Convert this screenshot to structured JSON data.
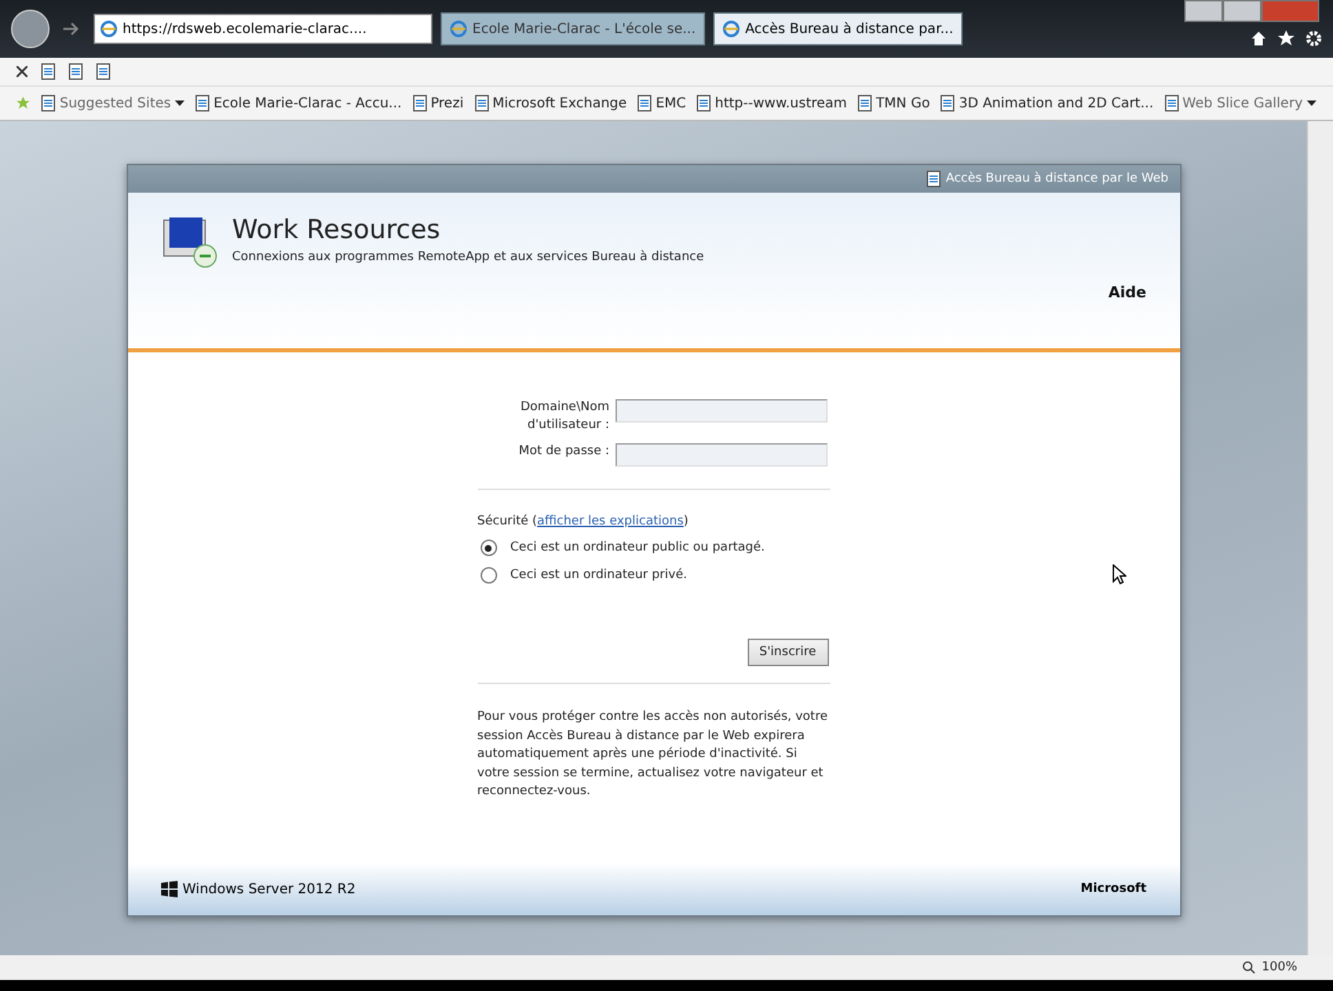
{
  "browser": {
    "address": "https://rdsweb.ecolemarie-clarac....",
    "tabs": [
      {
        "label": "Ecole Marie-Clarac - L'école se...",
        "selected": false
      },
      {
        "label": "Accès Bureau à distance par...",
        "selected": true
      }
    ],
    "favorites": [
      {
        "label": "Suggested Sites",
        "kind": "dropdown"
      },
      {
        "label": "Ecole Marie-Clarac - Accu...",
        "kind": "page"
      },
      {
        "label": "Prezi",
        "kind": "page"
      },
      {
        "label": "Microsoft Exchange",
        "kind": "page"
      },
      {
        "label": "EMC",
        "kind": "page"
      },
      {
        "label": "http--www.ustream",
        "kind": "page"
      },
      {
        "label": "TMN Go",
        "kind": "page"
      },
      {
        "label": "3D Animation and 2D Cart...",
        "kind": "page"
      },
      {
        "label": "Web Slice Gallery",
        "kind": "dropdown"
      }
    ],
    "zoom": "100%"
  },
  "page": {
    "top_link": "Accès Bureau à distance par le Web",
    "title": "Work Resources",
    "subtitle": "Connexions aux programmes RemoteApp et aux services Bureau à distance",
    "help": "Aide",
    "fields": [
      {
        "label": "Domaine\\Nom d'utilisateur :"
      },
      {
        "label": "Mot de passe :"
      }
    ],
    "security_label": "Sécurité (",
    "security_link": "afficher les explications",
    "security_close": ")",
    "options": [
      {
        "label": "Ceci est un ordinateur public ou partagé.",
        "selected": true
      },
      {
        "label": "Ceci est un ordinateur privé.",
        "selected": false
      }
    ],
    "submit": "S'inscrire",
    "notice": "Pour vous protéger contre les accès non autorisés, votre session Accès Bureau à distance par le Web expirera automatiquement après une période d'inactivité. Si votre session se termine, actualisez votre navigateur et reconnectez-vous.",
    "footer_left": "Windows Server 2012 R2",
    "footer_right": "Microsoft"
  }
}
